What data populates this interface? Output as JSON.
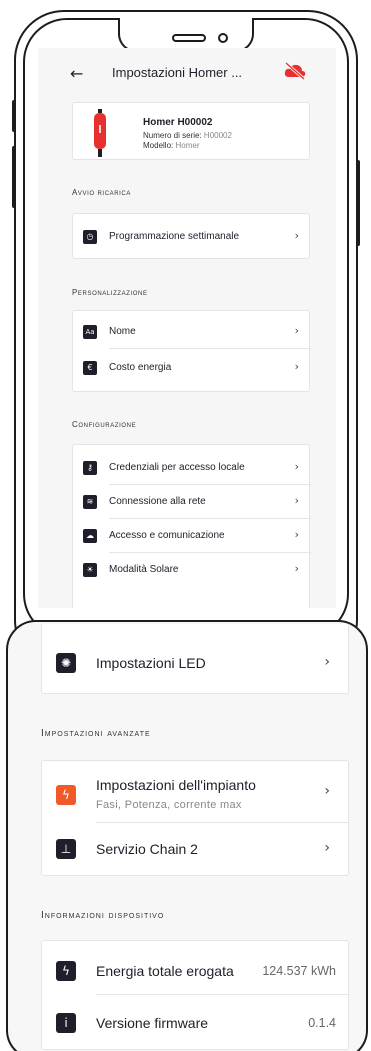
{
  "topbar": {
    "title": "Impostazioni Homer ...",
    "back_icon": "arrow-left-icon",
    "cloud_icon": "cloud-off-icon",
    "accent": "#e8312f"
  },
  "device": {
    "name": "Homer H00002",
    "serial_label": "Numero di serie:",
    "serial_value": "H00002",
    "model_label": "Modello:",
    "model_value": "Homer"
  },
  "sections": {
    "avvio": {
      "label": "Avvio ricarica",
      "items": [
        {
          "label": "Programmazione settimanale",
          "icon": "clock-icon"
        }
      ]
    },
    "personalizzazione": {
      "label": "Personalizzazione",
      "items": [
        {
          "label": "Nome",
          "icon": "text-icon"
        },
        {
          "label": "Costo energia",
          "icon": "euro-icon"
        }
      ]
    },
    "configurazione": {
      "label": "Configurazione",
      "items": [
        {
          "label": "Credenziali per accesso locale",
          "icon": "key-icon"
        },
        {
          "label": "Connessione alla rete",
          "icon": "wifi-icon"
        },
        {
          "label": "Accesso e comunicazione",
          "icon": "cloud-icon"
        },
        {
          "label": "Modalità Solare",
          "icon": "sun-icon"
        }
      ]
    }
  },
  "zoom": {
    "led": {
      "label": "Impostazioni LED",
      "icon": "led-icon"
    },
    "avanzate": {
      "label": "Impostazioni avanzate",
      "items": [
        {
          "label": "Impostazioni dell'impianto",
          "sub": "Fasi, Potenza, corrente max",
          "icon": "bolt-icon",
          "color": "#f05a28"
        },
        {
          "label": "Servizio Chain 2",
          "icon": "network-icon"
        }
      ]
    },
    "info": {
      "label": "Informazioni dispositivo",
      "items": [
        {
          "label": "Energia totale erogata",
          "value": "124.537 kWh",
          "icon": "bolt-icon"
        },
        {
          "label": "Versione firmware",
          "value": "0.1.4",
          "icon": "info-icon"
        }
      ]
    }
  }
}
